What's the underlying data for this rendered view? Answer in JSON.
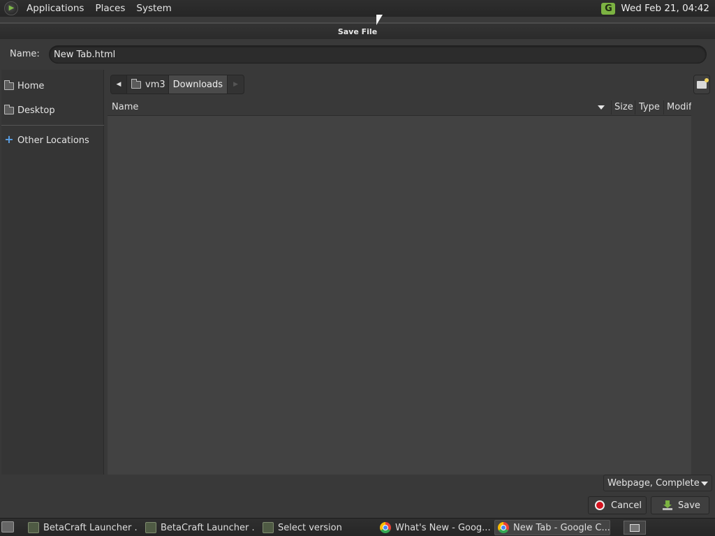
{
  "top_panel": {
    "menus": [
      "Applications",
      "Places",
      "System"
    ],
    "tray_icon": "G",
    "clock": "Wed Feb 21, 04:42"
  },
  "dialog": {
    "title": "Save File",
    "name_label": "Name:",
    "name_value": "New Tab.html",
    "sidebar": {
      "items": [
        {
          "label": "Home",
          "icon": "home-folder-icon"
        },
        {
          "label": "Desktop",
          "icon": "desktop-folder-icon"
        },
        {
          "label": "Other Locations",
          "icon": "plus-icon"
        }
      ]
    },
    "path": [
      "vm3",
      "Downloads"
    ],
    "columns": [
      "Name",
      "Size",
      "Type",
      "Modif"
    ],
    "filter": "Webpage, Complete",
    "cancel_label": "Cancel",
    "save_label": "Save"
  },
  "taskbar": {
    "tasks": [
      {
        "label": "BetaCraft Launcher ...",
        "icon": "betacraft-icon"
      },
      {
        "label": "BetaCraft Launcher ...",
        "icon": "betacraft-icon"
      },
      {
        "label": "Select version",
        "icon": "betacraft-icon"
      },
      {
        "label": "What's New - Goog...",
        "icon": "chrome-icon"
      },
      {
        "label": "New Tab - Google C...",
        "icon": "chrome-icon"
      }
    ]
  },
  "colors": {
    "accent_green": "#7cb342",
    "cancel_red": "#d4121e",
    "background": "#3a3a3a"
  }
}
